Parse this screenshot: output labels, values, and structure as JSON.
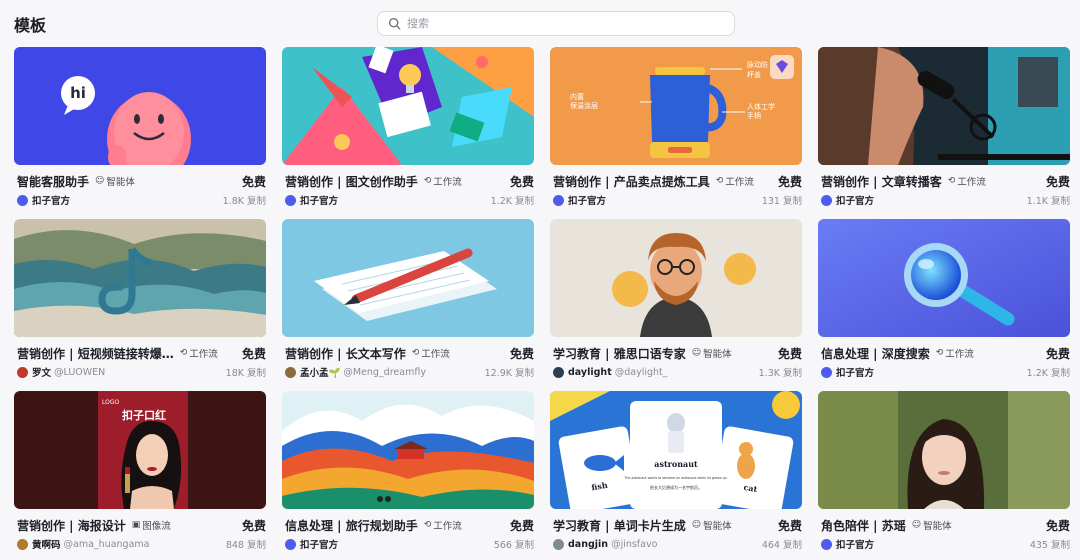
{
  "page": {
    "title": "模板"
  },
  "search": {
    "placeholder": "搜索",
    "icon": "search-icon"
  },
  "tag_icons": {
    "智能体": "☺",
    "工作流": "⟲",
    "图像流": "▣"
  },
  "colors": {
    "accent": "#4e5bf0",
    "text": "#1f1f29",
    "muted": "#8a8a96"
  },
  "cards": [
    {
      "title": "智能客服助手",
      "tag": "智能体",
      "tag_icon": "☺",
      "price": "免费",
      "author": "扣子官方",
      "handle": "",
      "uses": "1.8K 复制",
      "avatar_color": "#4e5bf0",
      "thumb": "robot"
    },
    {
      "title": "营销创作 | 图文创作助手",
      "tag": "工作流",
      "tag_icon": "⟲",
      "price": "免费",
      "author": "扣子官方",
      "handle": "",
      "uses": "1.2K 复制",
      "avatar_color": "#4e5bf0",
      "thumb": "colorful"
    },
    {
      "title": "营销创作 | 产品卖点提炼工具",
      "tag": "工作流",
      "tag_icon": "⟲",
      "price": "免费",
      "author": "扣子官方",
      "handle": "",
      "uses": "131 复制",
      "avatar_color": "#4e5bf0",
      "thumb": "kettle"
    },
    {
      "title": "营销创作 | 文章转播客",
      "tag": "工作流",
      "tag_icon": "⟲",
      "price": "免费",
      "author": "扣子官方",
      "handle": "",
      "uses": "1.1K 复制",
      "avatar_color": "#4e5bf0",
      "thumb": "mic"
    },
    {
      "title": "营销创作 | 短视频链接转爆…",
      "tag": "工作流",
      "tag_icon": "⟲",
      "price": "免费",
      "author": "罗文",
      "handle": "@LUOWEN",
      "uses": "18K 复制",
      "avatar_color": "#c0392b",
      "thumb": "wave"
    },
    {
      "title": "营销创作 | 长文本写作",
      "tag": "工作流",
      "tag_icon": "⟲",
      "price": "免费",
      "author": "孟小孟🌱",
      "handle": "@Meng_dreamfly",
      "uses": "12.9K 复制",
      "avatar_color": "#8a6d3b",
      "thumb": "pen"
    },
    {
      "title": "学习教育 | 雅思口语专家",
      "tag": "智能体",
      "tag_icon": "☺",
      "price": "免费",
      "author": "daylight",
      "handle": "@daylight_",
      "uses": "1.3K 复制",
      "avatar_color": "#2c3e50",
      "thumb": "teacher"
    },
    {
      "title": "信息处理 | 深度搜索",
      "tag": "工作流",
      "tag_icon": "⟲",
      "price": "免费",
      "author": "扣子官方",
      "handle": "",
      "uses": "1.2K 复制",
      "avatar_color": "#4e5bf0",
      "thumb": "magnifier"
    },
    {
      "title": "营销创作 | 海报设计",
      "tag": "图像流",
      "tag_icon": "▣",
      "price": "免费",
      "author": "黄啊码",
      "handle": "@ama_huangama",
      "uses": "848 复制",
      "avatar_color": "#b07b2c",
      "thumb": "poster"
    },
    {
      "title": "信息处理 | 旅行规划助手",
      "tag": "工作流",
      "tag_icon": "⟲",
      "price": "免费",
      "author": "扣子官方",
      "handle": "",
      "uses": "566 复制",
      "avatar_color": "#4e5bf0",
      "thumb": "mountain"
    },
    {
      "title": "学习教育 | 单词卡片生成",
      "tag": "智能体",
      "tag_icon": "☺",
      "price": "免费",
      "author": "dangjin",
      "handle": "@jinsfavo",
      "uses": "464 复制",
      "avatar_color": "#7f8c8d",
      "thumb": "cards"
    },
    {
      "title": "角色陪伴 | 苏瑶",
      "tag": "智能体",
      "tag_icon": "☺",
      "price": "免费",
      "author": "扣子官方",
      "handle": "",
      "uses": "435 复制",
      "avatar_color": "#4e5bf0",
      "thumb": "portrait"
    }
  ],
  "thumb_text": {
    "robot_bubble": "hi",
    "kettle_labels": [
      "内置",
      "保温涂层",
      "脉动防",
      "杯盖",
      "人体工学",
      "手柄"
    ],
    "poster_logo": "LOGO",
    "poster_title": "扣子口红",
    "cards_words": [
      "astronaut",
      "fish",
      "cat"
    ],
    "cards_sentence_en": "The astronaut wants to become an astronaut when he grows up.",
    "cards_sentence_zh": "他长大后想成为一名宇航员。"
  }
}
